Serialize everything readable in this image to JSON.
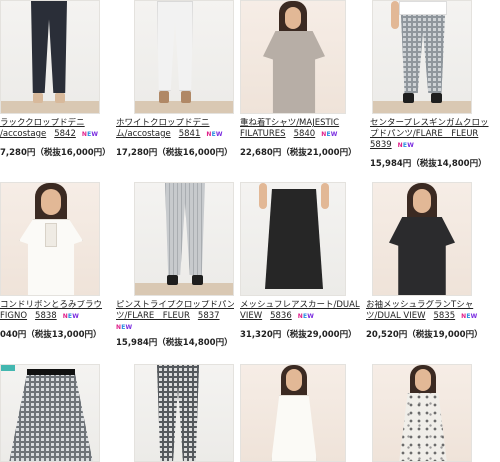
{
  "products": [
    {
      "title_lines": [
        "ラッククロップドデニ",
        "/accostage"
      ],
      "code": "5842",
      "new": true,
      "price": "7,280円（税抜16,000円）"
    },
    {
      "title_lines": [
        "ホワイトクロップドデニ",
        "ム/accostage"
      ],
      "code": "5841",
      "new": true,
      "price": "17,280円（税抜16,000円）"
    },
    {
      "title_lines": [
        "重ね着Tシャツ/MAJESTIC",
        "FILATURES"
      ],
      "code": "5840",
      "new": true,
      "price": "22,680円（税抜21,000円）"
    },
    {
      "title_lines": [
        "センタープレスギンガムクロッ",
        "プドパンツ/FLARE　FLEUR"
      ],
      "code": "5839",
      "new": true,
      "price": "15,984円（税抜14,800円）"
    },
    {
      "title_lines": [
        "コンドリボンとろみブラウ",
        "FIGNO"
      ],
      "code": "5838",
      "new": true,
      "price": "040円（税抜13,000円）"
    },
    {
      "title_lines": [
        "ピンストライプクロップドパン",
        "ツ/FLARE　FLEUR"
      ],
      "code": "5837",
      "new": true,
      "price": "15,984円（税抜14,800円）"
    },
    {
      "title_lines": [
        "メッシュフレアスカート/DUAL",
        "VIEW"
      ],
      "code": "5836",
      "new": true,
      "price": "31,320円（税抜29,000円）"
    },
    {
      "title_lines": [
        "お袖メッシュラグランTシャ",
        "ツ/DUAL VIEW"
      ],
      "code": "5835",
      "new": true,
      "price": "20,520円（税抜19,000円）"
    }
  ],
  "new_badge": {
    "n": "N",
    "e": "E",
    "w": "W"
  },
  "colors": {
    "accent_new_n": "#e0208a",
    "accent_new_e": "#2a8de0",
    "accent_new_w": "#7a2ce0"
  }
}
